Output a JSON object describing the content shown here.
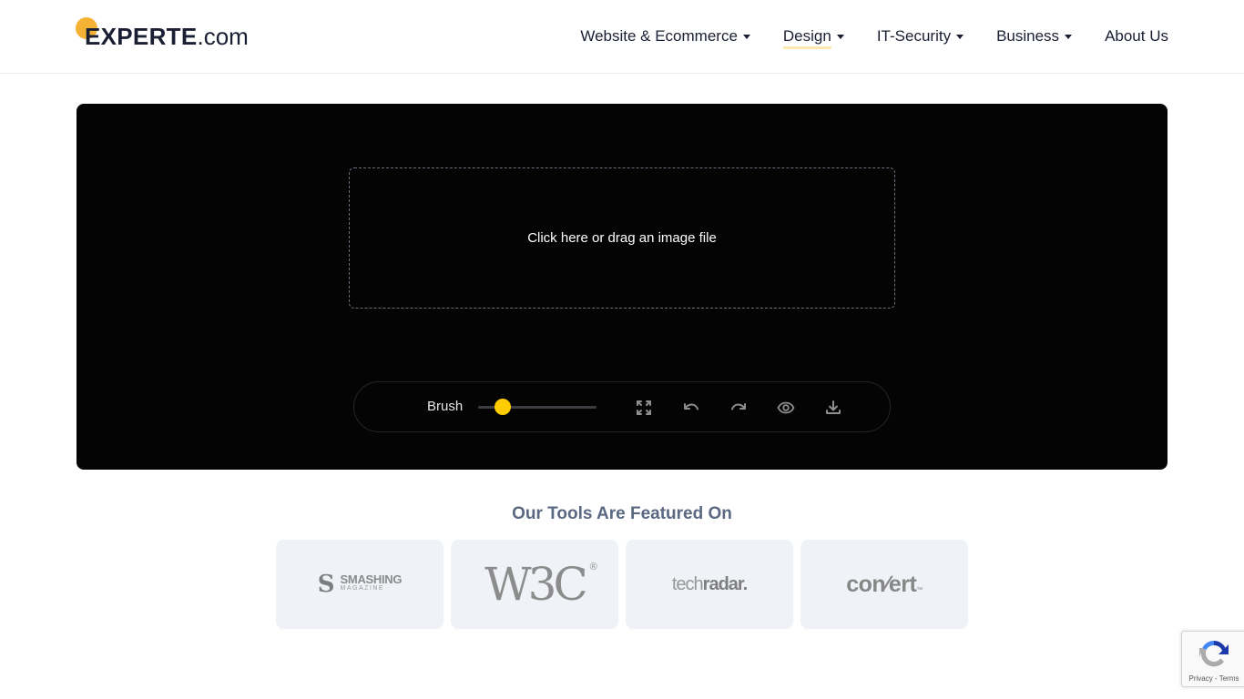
{
  "header": {
    "logo": {
      "brand": "EXPERTE",
      "suffix": ".com",
      "accent_color": "#f5b335"
    },
    "nav": [
      {
        "label": "Website & Ecommerce",
        "has_dropdown": true,
        "active": false
      },
      {
        "label": "Design",
        "has_dropdown": true,
        "active": true
      },
      {
        "label": "IT-Security",
        "has_dropdown": true,
        "active": false
      },
      {
        "label": "Business",
        "has_dropdown": true,
        "active": false
      },
      {
        "label": "About Us",
        "has_dropdown": false,
        "active": false
      }
    ]
  },
  "editor": {
    "dropzone_text": "Click here or drag an image file",
    "toolbar": {
      "brush_label": "Brush",
      "brush_size_fraction": 0.21,
      "slider_color": "#ffcc00",
      "tools": [
        {
          "name": "fullscreen",
          "icon": "expand-icon"
        },
        {
          "name": "undo",
          "icon": "undo-icon"
        },
        {
          "name": "redo",
          "icon": "redo-icon"
        },
        {
          "name": "preview",
          "icon": "eye-icon"
        },
        {
          "name": "download",
          "icon": "download-icon"
        }
      ]
    }
  },
  "featured": {
    "title": "Our Tools Are Featured On",
    "logos": [
      {
        "name": "Smashing Magazine",
        "main": "SMASHING",
        "sub": "MAGAZINE",
        "glyph": "S"
      },
      {
        "name": "W3C",
        "text": "W3C",
        "reg": "®"
      },
      {
        "name": "TechRadar",
        "light": "tech",
        "bold": "radar."
      },
      {
        "name": "Convert",
        "text": "con∕ert",
        "tm": "™"
      }
    ]
  },
  "recaptcha": {
    "links": "Privacy - Terms"
  }
}
